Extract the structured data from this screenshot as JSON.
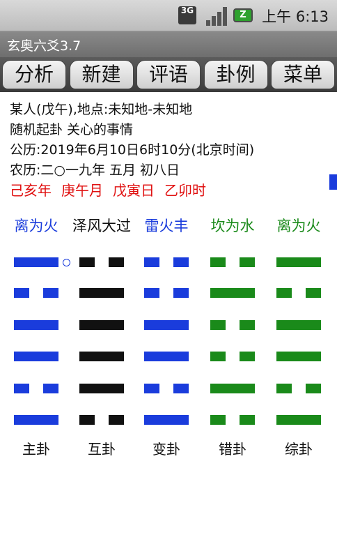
{
  "status_bar": {
    "network_label": "3G",
    "battery_label": "Z",
    "time": "上午 6:13"
  },
  "app": {
    "title": "玄奥六爻3.7"
  },
  "tabs": [
    {
      "label": "分析"
    },
    {
      "label": "新建"
    },
    {
      "label": "评语"
    },
    {
      "label": "卦例"
    },
    {
      "label": "菜单"
    }
  ],
  "info": {
    "line1": "某人(戊午),地点:未知地-未知地",
    "line2": "随机起卦  关心的事情",
    "line3": "公历:2019年6月10日6时10分(北京时间)",
    "line4": "农历:二○一九年 五月 初八日",
    "ganzhi": [
      "己亥年",
      "庚午月",
      "戊寅日",
      "乙卯时"
    ]
  },
  "colors": {
    "blue": "#1a3cdc",
    "black": "#111111",
    "green": "#1a8a1a",
    "red": "#e01010"
  },
  "hexagrams": [
    {
      "name": "离为火",
      "label": "主卦",
      "color": "blue",
      "lines_top_to_bottom": [
        "yang",
        "yin",
        "yang",
        "yang",
        "yin",
        "yang"
      ],
      "moving_line": 1
    },
    {
      "name": "泽风大过",
      "label": "互卦",
      "color": "black",
      "lines_top_to_bottom": [
        "yin",
        "yang",
        "yang",
        "yang",
        "yang",
        "yin"
      ]
    },
    {
      "name": "雷火丰",
      "label": "变卦",
      "color": "blue",
      "lines_top_to_bottom": [
        "yin",
        "yin",
        "yang",
        "yang",
        "yin",
        "yang"
      ]
    },
    {
      "name": "坎为水",
      "label": "错卦",
      "color": "green",
      "lines_top_to_bottom": [
        "yin",
        "yang",
        "yin",
        "yin",
        "yang",
        "yin"
      ]
    },
    {
      "name": "离为火",
      "label": "综卦",
      "color": "green",
      "lines_top_to_bottom": [
        "yang",
        "yin",
        "yang",
        "yang",
        "yin",
        "yang"
      ]
    }
  ]
}
